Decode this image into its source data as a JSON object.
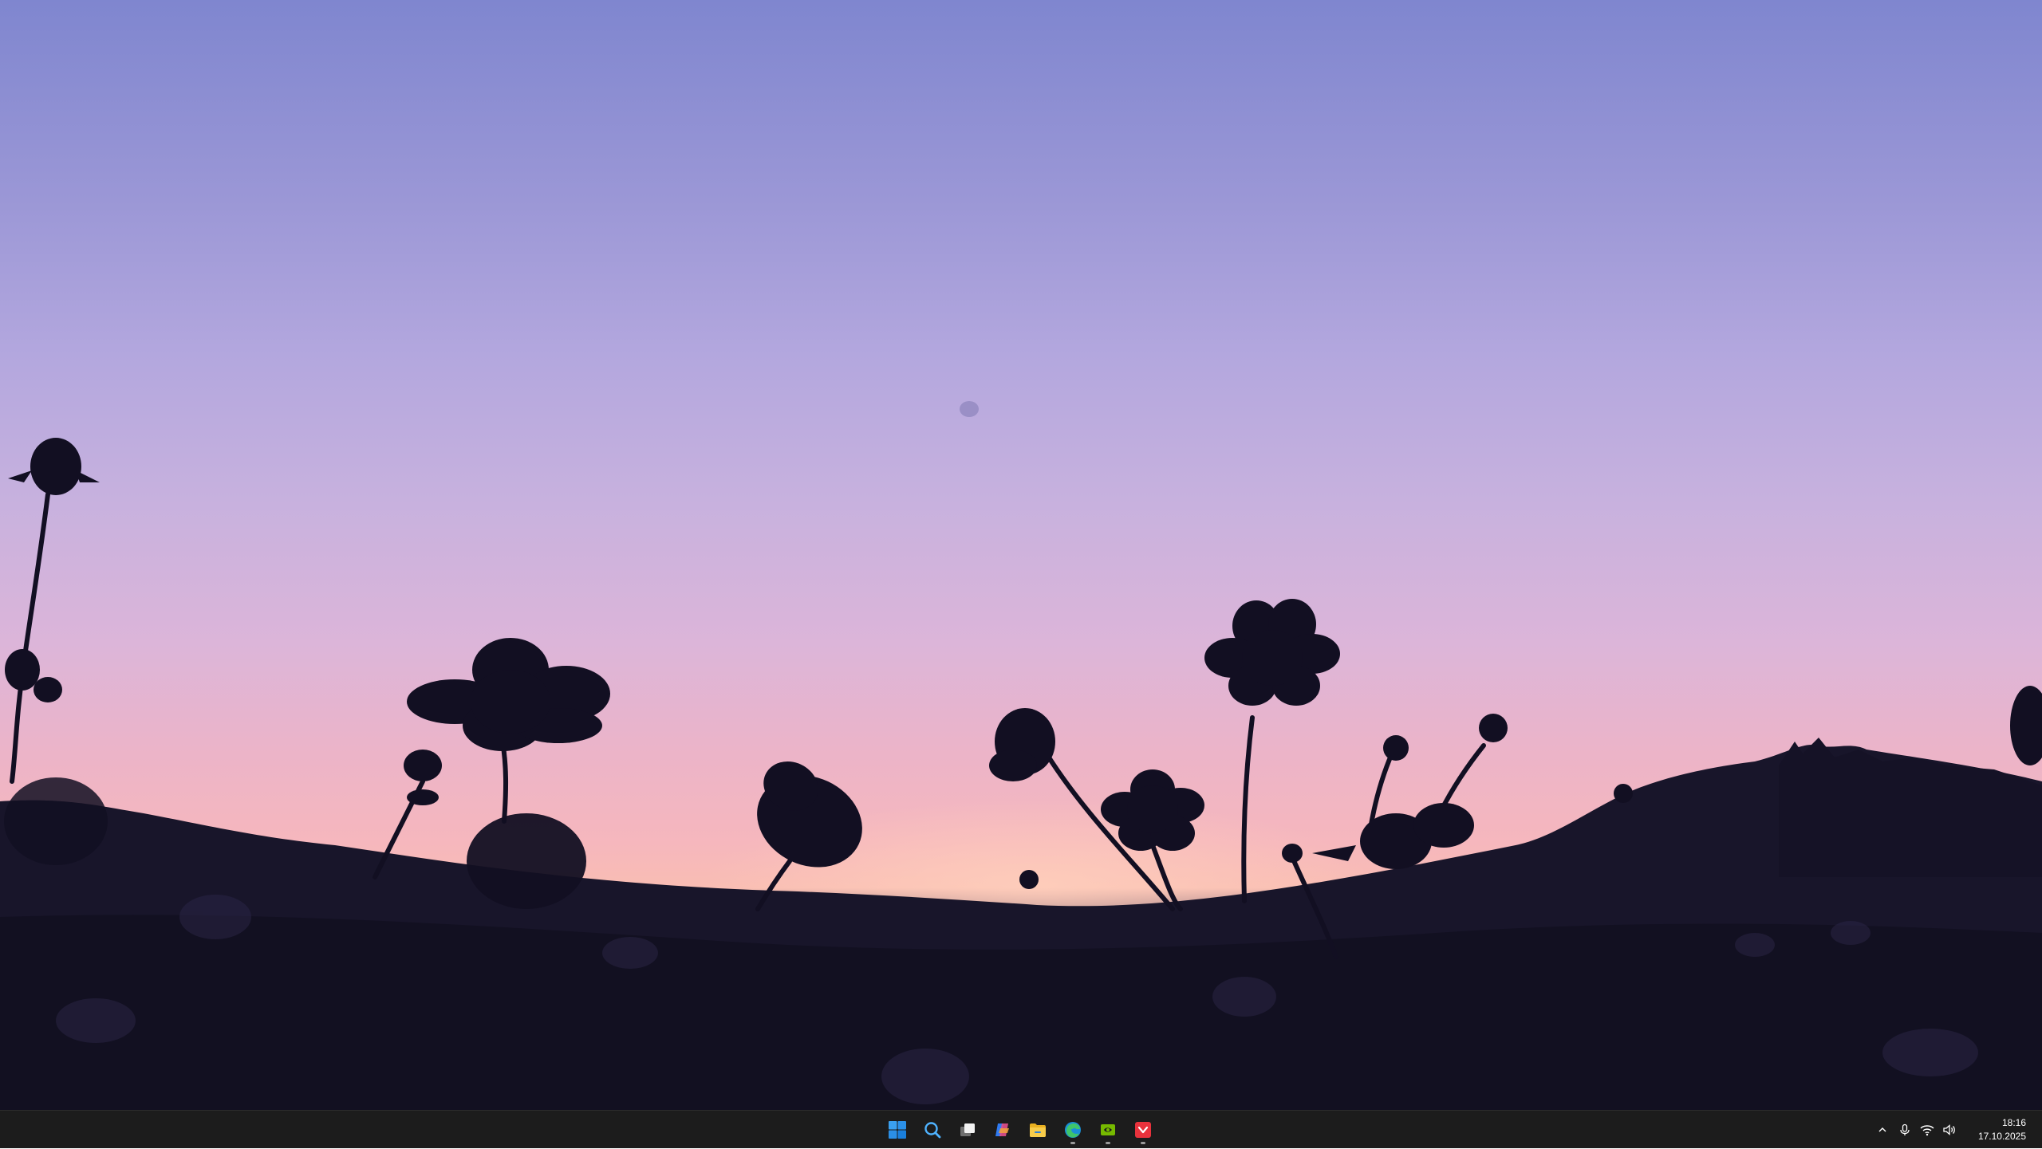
{
  "wallpaper": {
    "description_icon": "flower-silhouette-icon"
  },
  "taskbar": {
    "apps": [
      {
        "name": "start-button",
        "icon": "windows-logo-icon",
        "running": false
      },
      {
        "name": "search-button",
        "icon": "search-icon",
        "running": false
      },
      {
        "name": "task-view-button",
        "icon": "task-view-icon",
        "running": false
      },
      {
        "name": "copilot-button",
        "icon": "copilot-icon",
        "running": false
      },
      {
        "name": "file-explorer-button",
        "icon": "folder-icon",
        "running": false
      },
      {
        "name": "edge-button",
        "icon": "edge-icon",
        "running": true
      },
      {
        "name": "nvidia-button",
        "icon": "nvidia-icon",
        "running": true
      },
      {
        "name": "app-red-button",
        "icon": "red-app-icon",
        "running": true
      }
    ],
    "tray": {
      "overflow_icon": "chevron-up-icon",
      "mic_icon": "microphone-icon",
      "wifi_icon": "wifi-icon",
      "volume_icon": "speaker-icon"
    },
    "clock": {
      "time": "18:16",
      "date": "17.10.2025"
    }
  },
  "colors": {
    "taskbar_bg": "#1c1c1c",
    "windows_blue": "#0078d4",
    "folder_yellow": "#f2c230",
    "nvidia_green": "#76b900",
    "red_app": "#e8323c"
  }
}
